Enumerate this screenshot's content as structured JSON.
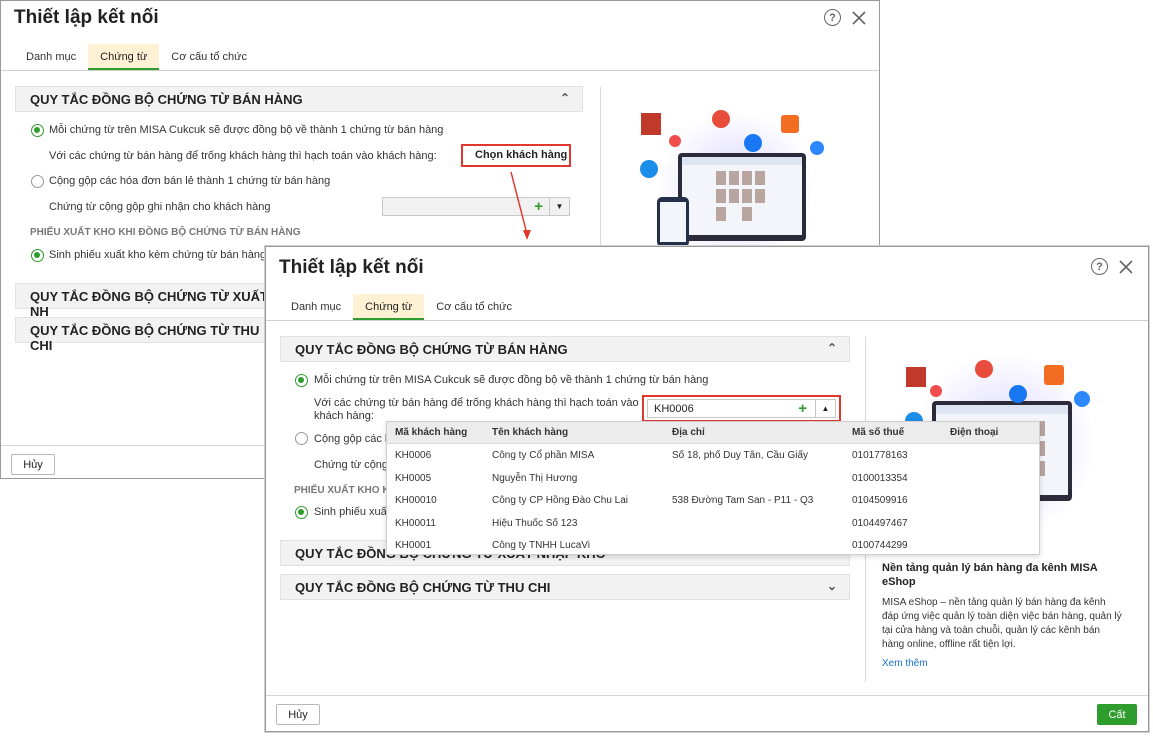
{
  "window_back": {
    "title": "Thiết lập kết nối",
    "tabs": [
      "Danh mục",
      "Chứng từ",
      "Cơ cấu tổ chức"
    ],
    "section_sales": "QUY TẮC ĐỒNG BỘ CHỨNG TỪ BÁN HÀNG",
    "opt1": "Mỗi chứng từ trên MISA Cukcuk sẽ được đồng bộ về thành 1 chứng từ bán hàng",
    "opt1_sub": "Với các chứng từ bán hàng để trống khách hàng thì hạch toán vào khách hàng:",
    "choose_customer": "Chọn khách hàng",
    "opt2": "Cộng gộp các hóa đơn bán lẻ thành 1 chứng từ bán hàng",
    "opt2_sub": "Chứng từ cộng gộp ghi nhận cho khách hàng",
    "warehouse_hdr": "PHIẾU XUẤT KHO KHI ĐỒNG BỘ CHỨNG TỪ BÁN HÀNG",
    "warehouse_opt": "Sinh phiếu xuất kho kèm chứng từ bán hàng",
    "section_export": "QUY TẮC ĐỒNG BỘ CHỨNG TỪ XUẤT NH",
    "section_cash": "QUY TẮC ĐỒNG BỘ CHỨNG TỪ THU CHI",
    "cancel": "Hủy"
  },
  "window_front": {
    "title": "Thiết lập kết nối",
    "tabs": [
      "Danh mục",
      "Chứng từ",
      "Cơ cấu tổ chức"
    ],
    "section_sales": "QUY TẮC ĐỒNG BỘ CHỨNG TỪ BÁN HÀNG",
    "opt1": "Mỗi chứng từ trên MISA Cukcuk sẽ được đồng bộ về thành 1 chứng từ bán hàng",
    "opt1_sub_a": "Với các chứng từ bán hàng để trống khách hàng thì hạch toán vào",
    "opt1_sub_b": "khách hàng:",
    "customer_value": "KH0006",
    "opt2": "Cộng gộp các hó",
    "opt2_sub": "Chứng từ cộng g",
    "warehouse_hdr": "PHIẾU XUẤT KHO K",
    "warehouse_opt": "Sinh phiếu xuất",
    "section_export": "QUY TẮC ĐỒNG BỘ CHỨNG TỪ XUẤT NHẬP KHO",
    "section_cash": "QUY TẮC ĐỒNG BỘ CHỨNG TỪ THU CHI",
    "cancel": "Hủy",
    "save": "Cất",
    "promo": {
      "title": "Nền tảng quản lý bán hàng đa kênh MISA eShop",
      "text": "MISA eShop – nền tảng quản lý bán hàng đa kênh đáp ứng việc quản lý toàn diện việc bán hàng, quản lý tại cửa hàng và toàn chuỗi, quản lý các kênh bán hàng online, offline rất tiện lợi.",
      "link": "Xem thêm"
    },
    "dropdown": {
      "columns": [
        "Mã khách hàng",
        "Tên khách hàng",
        "Địa chỉ",
        "Mã số thuế",
        "Điện thoại"
      ],
      "rows": [
        [
          "KH0006",
          "Công ty Cổ phần MISA",
          "Số 18, phố Duy Tân, Cầu Giấy",
          "0101778163",
          ""
        ],
        [
          "KH0005",
          "Nguyễn Thị Hương",
          "",
          "0100013354",
          ""
        ],
        [
          "KH00010",
          "Công ty CP Hồng Đào Chu Lai",
          "538 Đường Tam San - P11 - Q3",
          "0104509916",
          ""
        ],
        [
          "KH00011",
          "Hiệu Thuốc Số 123",
          "",
          "0104497467",
          ""
        ],
        [
          "KH0001",
          "Công ty TNHH LucaVi",
          "",
          "0100744299",
          ""
        ]
      ]
    }
  },
  "colors": {
    "accent_green": "#2e9d2e",
    "highlight_red": "#e0382f",
    "active_tab": "#fff1d4"
  }
}
